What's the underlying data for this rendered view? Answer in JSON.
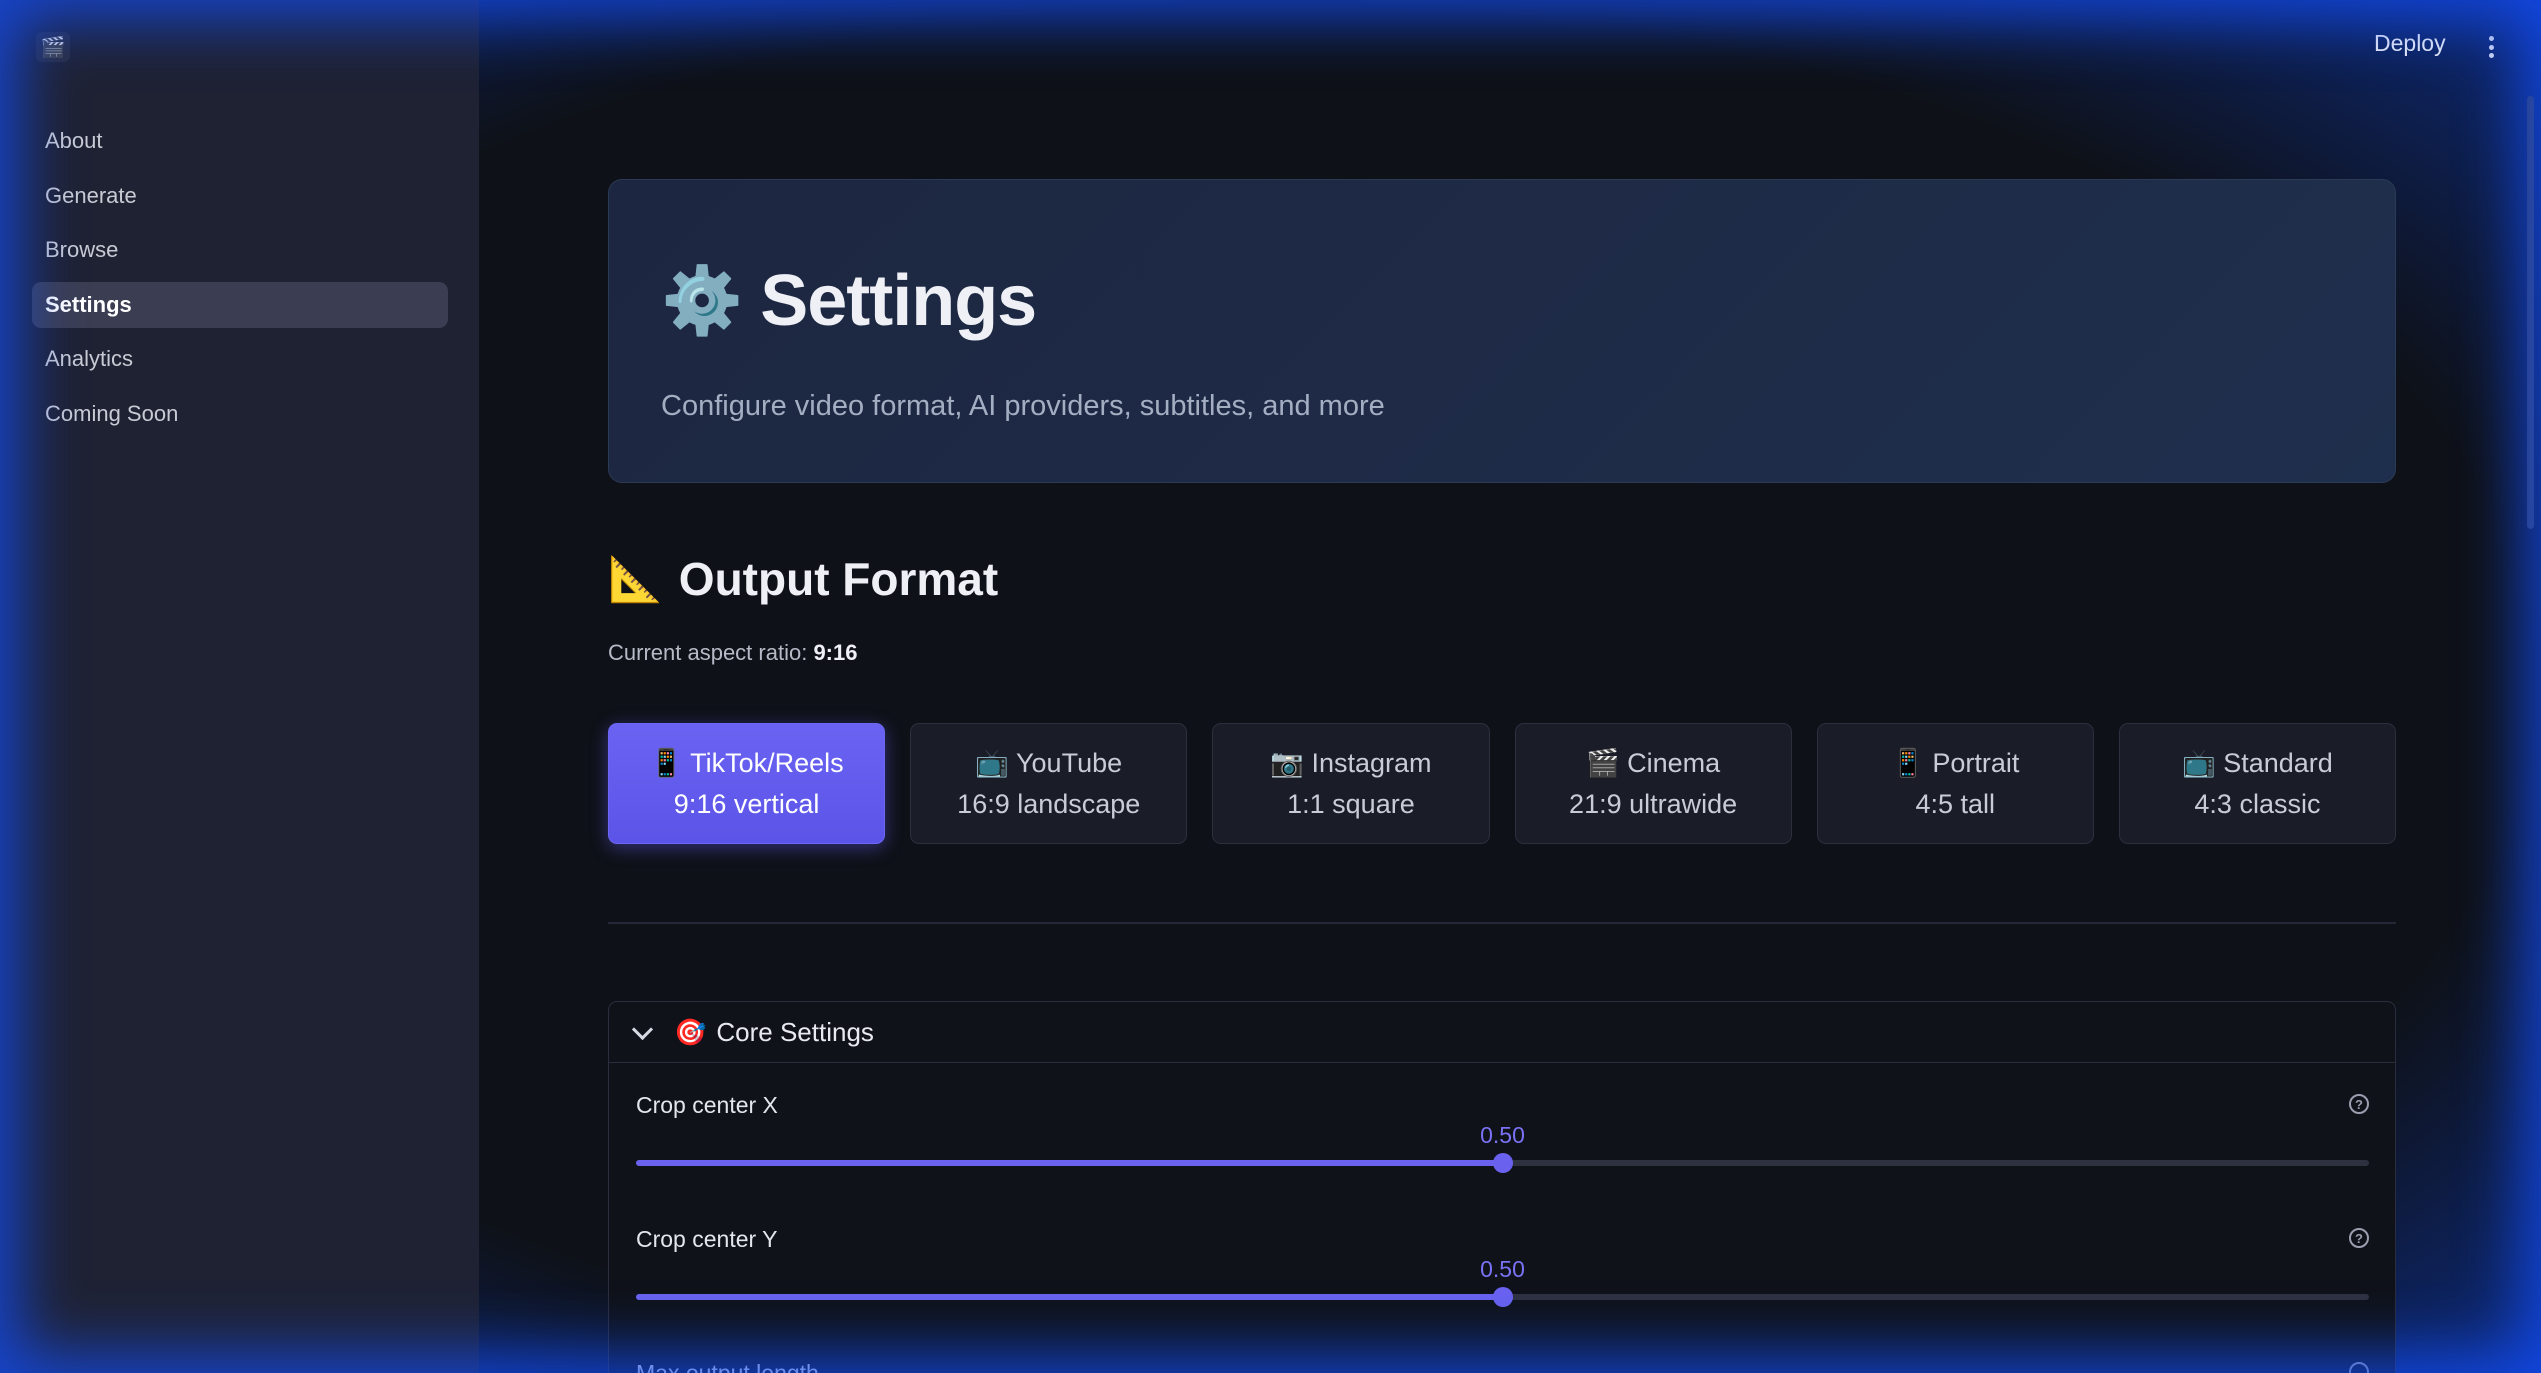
{
  "app": {
    "logo_icon": "🎬"
  },
  "sidebar": {
    "items": [
      {
        "label": "About",
        "active": false
      },
      {
        "label": "Generate",
        "active": false
      },
      {
        "label": "Browse",
        "active": false
      },
      {
        "label": "Settings",
        "active": true
      },
      {
        "label": "Analytics",
        "active": false
      },
      {
        "label": "Coming Soon",
        "active": false
      }
    ]
  },
  "header": {
    "deploy_label": "Deploy",
    "menu_icon": "kebab-menu-icon"
  },
  "hero": {
    "icon": "⚙️",
    "title": "Settings",
    "subtitle": "Configure video format, AI providers, subtitles, and more"
  },
  "output_format": {
    "icon": "📐",
    "title": "Output Format",
    "current_label": "Current aspect ratio:",
    "current_value": "9:16",
    "options": [
      {
        "icon": "📱",
        "name": "TikTok/Reels",
        "desc": "9:16 vertical",
        "selected": true
      },
      {
        "icon": "📺",
        "name": "YouTube",
        "desc": "16:9 landscape",
        "selected": false
      },
      {
        "icon": "📷",
        "name": "Instagram",
        "desc": "1:1 square",
        "selected": false
      },
      {
        "icon": "🎬",
        "name": "Cinema",
        "desc": "21:9 ultrawide",
        "selected": false
      },
      {
        "icon": "📱",
        "name": "Portrait",
        "desc": "4:5 tall",
        "selected": false
      },
      {
        "icon": "📺",
        "name": "Standard",
        "desc": "4:3 classic",
        "selected": false
      }
    ]
  },
  "core_settings": {
    "icon": "🎯",
    "title": "Core Settings",
    "expanded": true,
    "sliders": [
      {
        "label": "Crop center X",
        "value": "0.50",
        "fraction": 0.5
      },
      {
        "label": "Crop center Y",
        "value": "0.50",
        "fraction": 0.5
      }
    ],
    "next_label": "Max output length"
  },
  "colors": {
    "accent": "#6a62ef",
    "sidebar_bg": "#1f2233",
    "main_bg": "#0e1117"
  }
}
